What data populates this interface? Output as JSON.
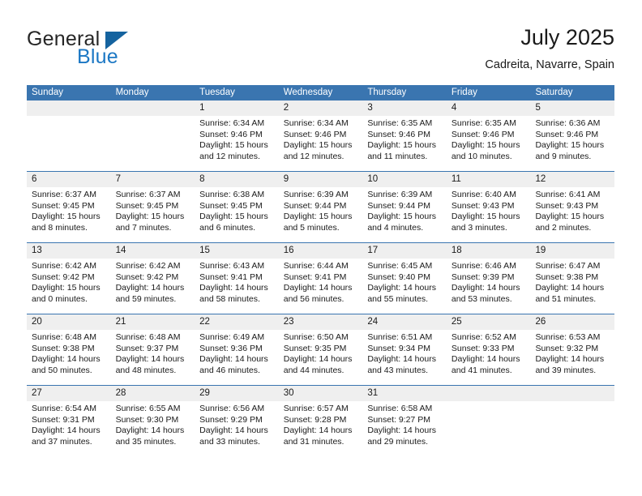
{
  "brand": {
    "name_top": "General",
    "name_bottom": "Blue",
    "triangle_color": "#15639f",
    "blue_color": "#1b77c4"
  },
  "header": {
    "title": "July 2025",
    "subtitle": "Cadreita, Navarre, Spain"
  },
  "colors": {
    "header_band": "#3a75b0",
    "daynum_strip": "#efefef",
    "text": "#1a1a1a",
    "header_text": "#ffffff"
  },
  "weekdays": [
    "Sunday",
    "Monday",
    "Tuesday",
    "Wednesday",
    "Thursday",
    "Friday",
    "Saturday"
  ],
  "weeks": [
    {
      "days": [
        {
          "num": "",
          "sunrise": "",
          "sunset": "",
          "daylight_a": "",
          "daylight_b": "",
          "empty": true
        },
        {
          "num": "",
          "sunrise": "",
          "sunset": "",
          "daylight_a": "",
          "daylight_b": "",
          "empty": true
        },
        {
          "num": "1",
          "sunrise": "Sunrise: 6:34 AM",
          "sunset": "Sunset: 9:46 PM",
          "daylight_a": "Daylight: 15 hours",
          "daylight_b": "and 12 minutes."
        },
        {
          "num": "2",
          "sunrise": "Sunrise: 6:34 AM",
          "sunset": "Sunset: 9:46 PM",
          "daylight_a": "Daylight: 15 hours",
          "daylight_b": "and 12 minutes."
        },
        {
          "num": "3",
          "sunrise": "Sunrise: 6:35 AM",
          "sunset": "Sunset: 9:46 PM",
          "daylight_a": "Daylight: 15 hours",
          "daylight_b": "and 11 minutes."
        },
        {
          "num": "4",
          "sunrise": "Sunrise: 6:35 AM",
          "sunset": "Sunset: 9:46 PM",
          "daylight_a": "Daylight: 15 hours",
          "daylight_b": "and 10 minutes."
        },
        {
          "num": "5",
          "sunrise": "Sunrise: 6:36 AM",
          "sunset": "Sunset: 9:46 PM",
          "daylight_a": "Daylight: 15 hours",
          "daylight_b": "and 9 minutes."
        }
      ]
    },
    {
      "days": [
        {
          "num": "6",
          "sunrise": "Sunrise: 6:37 AM",
          "sunset": "Sunset: 9:45 PM",
          "daylight_a": "Daylight: 15 hours",
          "daylight_b": "and 8 minutes."
        },
        {
          "num": "7",
          "sunrise": "Sunrise: 6:37 AM",
          "sunset": "Sunset: 9:45 PM",
          "daylight_a": "Daylight: 15 hours",
          "daylight_b": "and 7 minutes."
        },
        {
          "num": "8",
          "sunrise": "Sunrise: 6:38 AM",
          "sunset": "Sunset: 9:45 PM",
          "daylight_a": "Daylight: 15 hours",
          "daylight_b": "and 6 minutes."
        },
        {
          "num": "9",
          "sunrise": "Sunrise: 6:39 AM",
          "sunset": "Sunset: 9:44 PM",
          "daylight_a": "Daylight: 15 hours",
          "daylight_b": "and 5 minutes."
        },
        {
          "num": "10",
          "sunrise": "Sunrise: 6:39 AM",
          "sunset": "Sunset: 9:44 PM",
          "daylight_a": "Daylight: 15 hours",
          "daylight_b": "and 4 minutes."
        },
        {
          "num": "11",
          "sunrise": "Sunrise: 6:40 AM",
          "sunset": "Sunset: 9:43 PM",
          "daylight_a": "Daylight: 15 hours",
          "daylight_b": "and 3 minutes."
        },
        {
          "num": "12",
          "sunrise": "Sunrise: 6:41 AM",
          "sunset": "Sunset: 9:43 PM",
          "daylight_a": "Daylight: 15 hours",
          "daylight_b": "and 2 minutes."
        }
      ]
    },
    {
      "days": [
        {
          "num": "13",
          "sunrise": "Sunrise: 6:42 AM",
          "sunset": "Sunset: 9:42 PM",
          "daylight_a": "Daylight: 15 hours",
          "daylight_b": "and 0 minutes."
        },
        {
          "num": "14",
          "sunrise": "Sunrise: 6:42 AM",
          "sunset": "Sunset: 9:42 PM",
          "daylight_a": "Daylight: 14 hours",
          "daylight_b": "and 59 minutes."
        },
        {
          "num": "15",
          "sunrise": "Sunrise: 6:43 AM",
          "sunset": "Sunset: 9:41 PM",
          "daylight_a": "Daylight: 14 hours",
          "daylight_b": "and 58 minutes."
        },
        {
          "num": "16",
          "sunrise": "Sunrise: 6:44 AM",
          "sunset": "Sunset: 9:41 PM",
          "daylight_a": "Daylight: 14 hours",
          "daylight_b": "and 56 minutes."
        },
        {
          "num": "17",
          "sunrise": "Sunrise: 6:45 AM",
          "sunset": "Sunset: 9:40 PM",
          "daylight_a": "Daylight: 14 hours",
          "daylight_b": "and 55 minutes."
        },
        {
          "num": "18",
          "sunrise": "Sunrise: 6:46 AM",
          "sunset": "Sunset: 9:39 PM",
          "daylight_a": "Daylight: 14 hours",
          "daylight_b": "and 53 minutes."
        },
        {
          "num": "19",
          "sunrise": "Sunrise: 6:47 AM",
          "sunset": "Sunset: 9:38 PM",
          "daylight_a": "Daylight: 14 hours",
          "daylight_b": "and 51 minutes."
        }
      ]
    },
    {
      "days": [
        {
          "num": "20",
          "sunrise": "Sunrise: 6:48 AM",
          "sunset": "Sunset: 9:38 PM",
          "daylight_a": "Daylight: 14 hours",
          "daylight_b": "and 50 minutes."
        },
        {
          "num": "21",
          "sunrise": "Sunrise: 6:48 AM",
          "sunset": "Sunset: 9:37 PM",
          "daylight_a": "Daylight: 14 hours",
          "daylight_b": "and 48 minutes."
        },
        {
          "num": "22",
          "sunrise": "Sunrise: 6:49 AM",
          "sunset": "Sunset: 9:36 PM",
          "daylight_a": "Daylight: 14 hours",
          "daylight_b": "and 46 minutes."
        },
        {
          "num": "23",
          "sunrise": "Sunrise: 6:50 AM",
          "sunset": "Sunset: 9:35 PM",
          "daylight_a": "Daylight: 14 hours",
          "daylight_b": "and 44 minutes."
        },
        {
          "num": "24",
          "sunrise": "Sunrise: 6:51 AM",
          "sunset": "Sunset: 9:34 PM",
          "daylight_a": "Daylight: 14 hours",
          "daylight_b": "and 43 minutes."
        },
        {
          "num": "25",
          "sunrise": "Sunrise: 6:52 AM",
          "sunset": "Sunset: 9:33 PM",
          "daylight_a": "Daylight: 14 hours",
          "daylight_b": "and 41 minutes."
        },
        {
          "num": "26",
          "sunrise": "Sunrise: 6:53 AM",
          "sunset": "Sunset: 9:32 PM",
          "daylight_a": "Daylight: 14 hours",
          "daylight_b": "and 39 minutes."
        }
      ]
    },
    {
      "days": [
        {
          "num": "27",
          "sunrise": "Sunrise: 6:54 AM",
          "sunset": "Sunset: 9:31 PM",
          "daylight_a": "Daylight: 14 hours",
          "daylight_b": "and 37 minutes."
        },
        {
          "num": "28",
          "sunrise": "Sunrise: 6:55 AM",
          "sunset": "Sunset: 9:30 PM",
          "daylight_a": "Daylight: 14 hours",
          "daylight_b": "and 35 minutes."
        },
        {
          "num": "29",
          "sunrise": "Sunrise: 6:56 AM",
          "sunset": "Sunset: 9:29 PM",
          "daylight_a": "Daylight: 14 hours",
          "daylight_b": "and 33 minutes."
        },
        {
          "num": "30",
          "sunrise": "Sunrise: 6:57 AM",
          "sunset": "Sunset: 9:28 PM",
          "daylight_a": "Daylight: 14 hours",
          "daylight_b": "and 31 minutes."
        },
        {
          "num": "31",
          "sunrise": "Sunrise: 6:58 AM",
          "sunset": "Sunset: 9:27 PM",
          "daylight_a": "Daylight: 14 hours",
          "daylight_b": "and 29 minutes."
        },
        {
          "num": "",
          "sunrise": "",
          "sunset": "",
          "daylight_a": "",
          "daylight_b": "",
          "empty": true
        },
        {
          "num": "",
          "sunrise": "",
          "sunset": "",
          "daylight_a": "",
          "daylight_b": "",
          "empty": true
        }
      ]
    }
  ]
}
